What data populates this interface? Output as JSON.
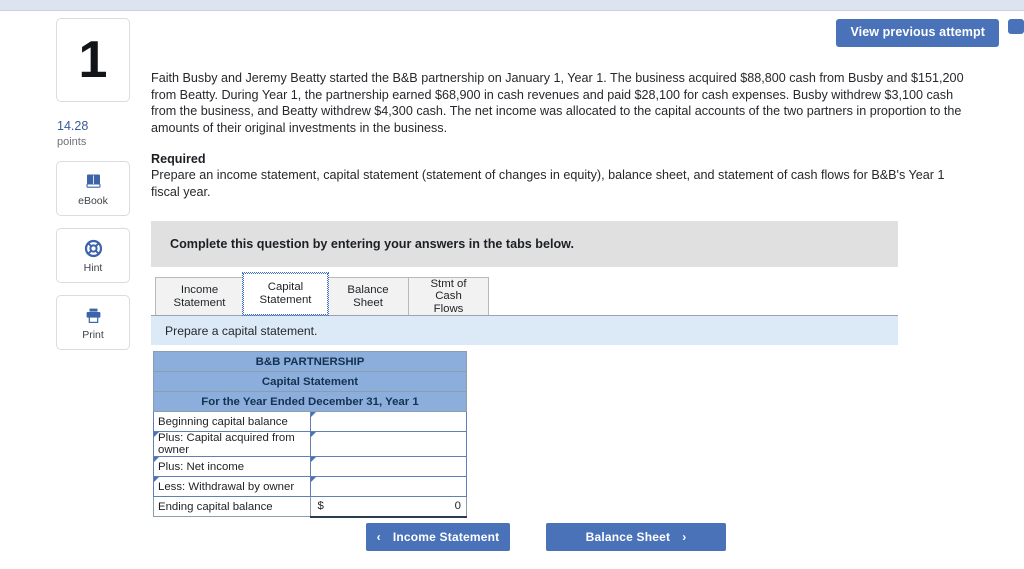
{
  "header": {
    "view_previous_label": "View previous attempt"
  },
  "rail": {
    "question_number": "1",
    "points_value": "14.28",
    "points_label": "points",
    "tools": [
      {
        "label": "eBook",
        "icon": "book-icon"
      },
      {
        "label": "Hint",
        "icon": "lifebuoy-icon"
      },
      {
        "label": "Print",
        "icon": "printer-icon"
      }
    ]
  },
  "question": {
    "body": "Faith Busby and Jeremy Beatty started the B&B partnership on January 1, Year 1. The business acquired $88,800 cash from Busby and $151,200 from Beatty. During Year 1, the partnership earned $68,900 in cash revenues and paid $28,100 for cash expenses. Busby withdrew $3,100 cash from the business, and Beatty withdrew $4,300 cash. The net income was allocated to the capital accounts of the two partners in proportion to the amounts of their original investments in the business.",
    "required_title": "Required",
    "required_body": "Prepare an income statement, capital statement (statement of changes in equity), balance sheet, and statement of cash flows for B&B's Year 1 fiscal year."
  },
  "instruction_banner": {
    "text": "Complete this question by entering your answers in the tabs below."
  },
  "tabs": [
    {
      "label": "Income\nStatement",
      "active": false
    },
    {
      "label": "Capital\nStatement",
      "active": true
    },
    {
      "label": "Balance Sheet",
      "active": false
    },
    {
      "label": "Stmt of Cash\nFlows",
      "active": false
    }
  ],
  "tab_instruction": {
    "text": "Prepare a capital statement."
  },
  "statement": {
    "title_lines": [
      "B&B PARTNERSHIP",
      "Capital Statement",
      "For the Year Ended December 31, Year 1"
    ],
    "rows": [
      {
        "label": "Beginning capital balance",
        "value": "",
        "currency": "",
        "has_label_marker": false,
        "has_value_marker": true,
        "is_total": false
      },
      {
        "label": "Plus: Capital acquired from owner",
        "value": "",
        "currency": "",
        "has_label_marker": true,
        "has_value_marker": true,
        "is_total": false
      },
      {
        "label": "Plus: Net income",
        "value": "",
        "currency": "",
        "has_label_marker": true,
        "has_value_marker": true,
        "is_total": false
      },
      {
        "label": "Less: Withdrawal by owner",
        "value": "",
        "currency": "",
        "has_label_marker": true,
        "has_value_marker": true,
        "is_total": false
      },
      {
        "label": "Ending capital balance",
        "value": "0",
        "currency": "$",
        "has_label_marker": false,
        "has_value_marker": false,
        "is_total": true
      }
    ]
  },
  "nav": {
    "prev_label": "Income Statement",
    "prev_chevron": "‹",
    "next_label": "Balance Sheet",
    "next_chevron": "›"
  },
  "colors": {
    "accent_blue": "#4a72b8",
    "table_header_blue": "#8caedc",
    "gray_banner": "#e0e0e0",
    "blue_bar": "#dceaf7"
  }
}
